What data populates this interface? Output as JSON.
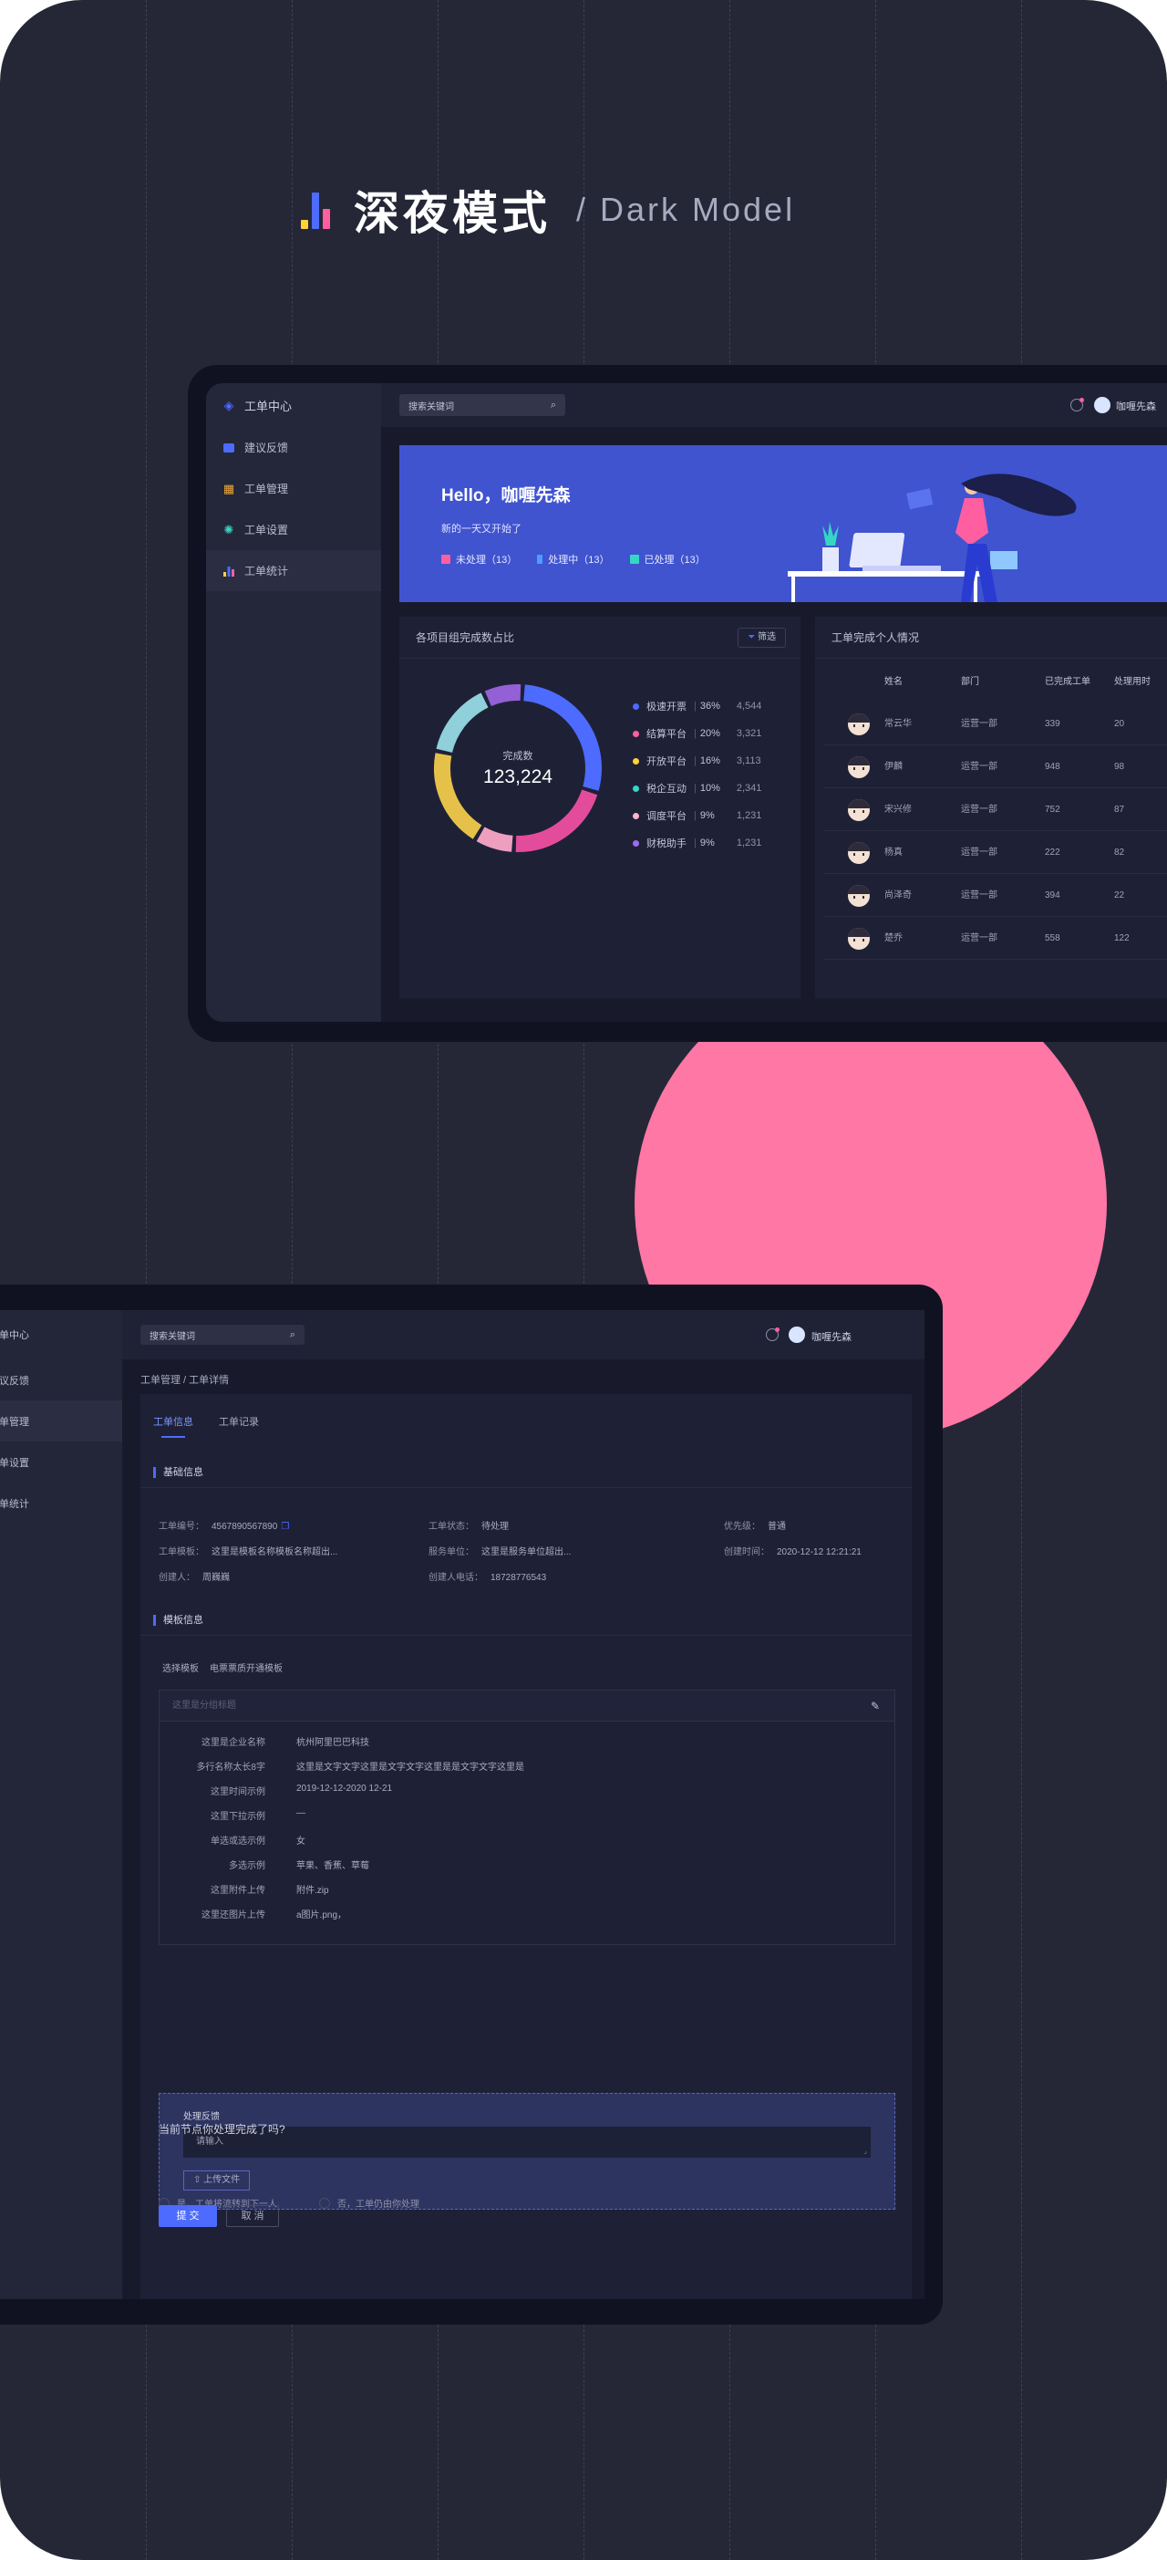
{
  "header": {
    "title": "深夜模式",
    "subtitle": "/ Dark  Model",
    "logo_colors": [
      "#ffd338",
      "#4d6bfe",
      "#ff5fa1"
    ]
  },
  "colors": {
    "accent": "#4d6bfe",
    "pink": "#ff77a4",
    "banner": "#4054d0"
  },
  "dashboard": {
    "brand": "工单中心",
    "sidebar": [
      {
        "label": "建议反馈",
        "icon": "feedback-icon"
      },
      {
        "label": "工单管理",
        "icon": "grid-icon"
      },
      {
        "label": "工单设置",
        "icon": "gear-icon"
      },
      {
        "label": "工单统计",
        "icon": "bar-chart-icon"
      }
    ],
    "search_placeholder": "搜索关键词",
    "user": "咖喱先森",
    "banner": {
      "greeting": "Hello，咖喱先森",
      "subtitle": "新的一天又开始了",
      "stats": [
        {
          "label": "未处理（13）",
          "color": "#ff5fa1"
        },
        {
          "label": "处理中（13）",
          "color": "#4d9dff"
        },
        {
          "label": "已处理（13）",
          "color": "#36d6c4"
        }
      ]
    },
    "donut_card": {
      "title": "各项目组完成数占比",
      "filter": "筛选",
      "center_label": "完成数",
      "center_value": "123,224"
    },
    "table_card": {
      "title": "工单完成个人情况",
      "columns": [
        "姓名",
        "部门",
        "已完成工单",
        "处理用时"
      ],
      "rows": [
        [
          "常云华",
          "运营一部",
          "339",
          "20"
        ],
        [
          "伊麟",
          "运营一部",
          "948",
          "98"
        ],
        [
          "宋兴修",
          "运营一部",
          "752",
          "87"
        ],
        [
          "杨真",
          "运营一部",
          "222",
          "82"
        ],
        [
          "尚泽奇",
          "运营一部",
          "394",
          "22"
        ],
        [
          "楚乔",
          "运营一部",
          "558",
          "122"
        ]
      ]
    }
  },
  "chart_data": {
    "type": "pie",
    "labels": [
      "极速开票",
      "结算平台",
      "开放平台",
      "税企互动",
      "调度平台",
      "财税助手"
    ],
    "percent_labels": [
      "36%",
      "20%",
      "16%",
      "10%",
      "9%",
      "9%"
    ],
    "values": [
      4544,
      3321,
      3113,
      2341,
      1231,
      1231
    ],
    "value_labels": [
      "4,544",
      "3,321",
      "3,113",
      "2,341",
      "1,231",
      "1,231"
    ],
    "colors": [
      "#4d6bfe",
      "#ff5fa1",
      "#ffd338",
      "#36d6c4",
      "#ffb3cc",
      "#9b6cf2"
    ],
    "arc_order": [
      0,
      1,
      4,
      2,
      3,
      5
    ],
    "arc_colors": [
      "#4d6bfe",
      "#e34c9a",
      "#ee9fc0",
      "#e6c14a",
      "#8fd0da",
      "#9360d6"
    ],
    "center_label": "完成数",
    "center_value": "123,224"
  },
  "detail": {
    "sidebar": [
      "建议反馈",
      "工单管理",
      "工单设置",
      "工单统计"
    ],
    "brand": "工单中心",
    "search_placeholder": "搜索关键词",
    "user": "咖喱先森",
    "breadcrumb": "工单管理 / 工单详情",
    "tabs": [
      "工单信息",
      "工单记录"
    ],
    "basic_title": "基础信息",
    "basic": [
      {
        "k": "工单编号：",
        "v": "4567890567890"
      },
      {
        "k": "工单状态：",
        "v": "待处理"
      },
      {
        "k": "优先级：",
        "v": "普通"
      },
      {
        "k": "工单模板：",
        "v": "这里是模板名称模板名称超出..."
      },
      {
        "k": "服务单位：",
        "v": "这里是服务单位超出..."
      },
      {
        "k": "创建时间：",
        "v": "2020-12-12 12:21:21"
      },
      {
        "k": "创建人：",
        "v": "周巍巍"
      },
      {
        "k": "创建人电话：",
        "v": "18728776543"
      }
    ],
    "template_title": "模板信息",
    "template_select_label": "选择模板",
    "template_select_value": "电票票质开通模板",
    "group_placeholder": "这里是分组标题",
    "fields": [
      {
        "k": "这里是企业名称",
        "v": "杭州阿里巴巴科技"
      },
      {
        "k": "多行名称太长8字",
        "v": "这里是文字文字这里是文字文字这里是是文字文字这里是"
      },
      {
        "k": "这里时间示例",
        "v": "2019-12-12-2020 12-21"
      },
      {
        "k": "这里下拉示例",
        "v": "—"
      },
      {
        "k": "单选或选示例",
        "v": "女"
      },
      {
        "k": "多选示例",
        "v": "苹果、香蕉、草莓"
      },
      {
        "k": "这里附件上传",
        "v": "附件.zip"
      },
      {
        "k": "这里还图片上传",
        "v": "a图片.png，"
      }
    ],
    "feedback_label": "处理反馈",
    "feedback_placeholder": "请输入",
    "upload_label": "上传文件",
    "question": "当前节点你处理完成了吗?",
    "options": [
      "是，工单将流转到下一人",
      "否，工单仍由你处理"
    ],
    "submit": "提 交",
    "cancel": "取 消"
  }
}
